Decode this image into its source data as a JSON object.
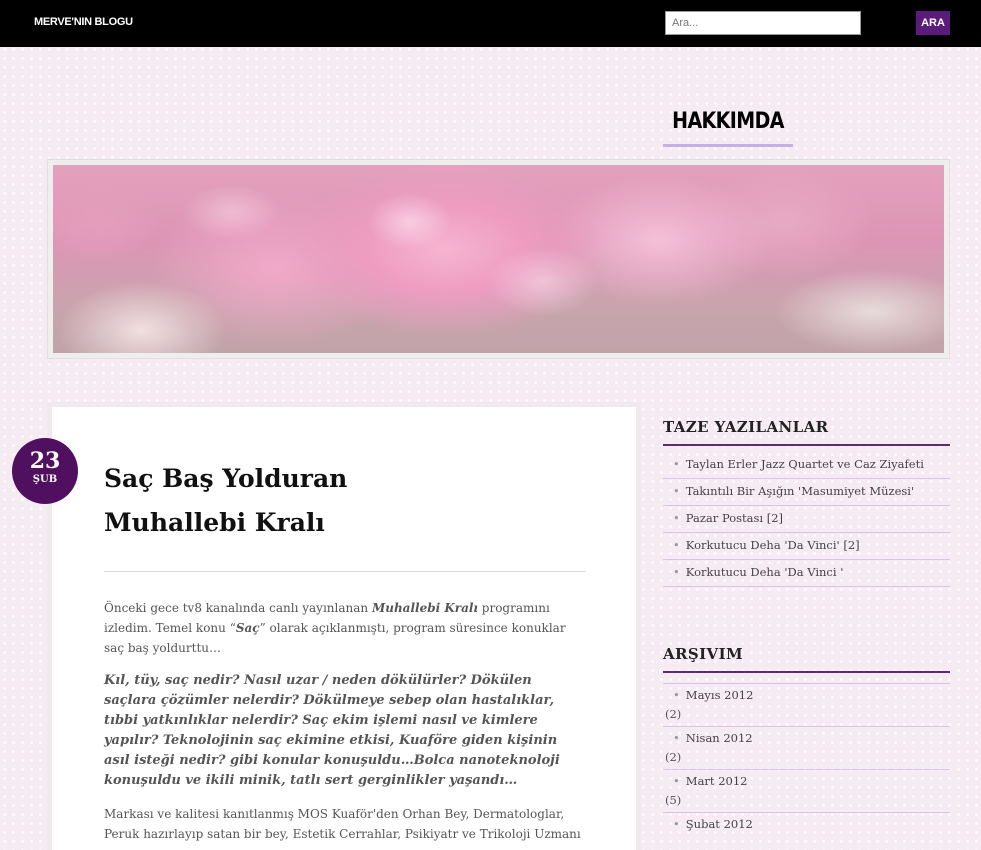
{
  "header": {
    "site_title": "MERVE'NIN BLOGU",
    "search_placeholder": "Ara...",
    "search_button": "ARA"
  },
  "nav": {
    "about_link": "HAKKIMDA"
  },
  "post": {
    "date_day": "23",
    "date_month": "ŞUB",
    "title_line1": "Saç Baş Yolduran",
    "title_line2": "Muhallebi Kralı",
    "p1_pre": "Önceki gece tv8 kanalında canlı yayınlanan ",
    "p1_program": "Muhallebi Kralı",
    "p1_mid": " programını izledim. Temel konu “",
    "p1_topic": "Saç",
    "p1_post": "” olarak açıklanmıştı, program süresince konuklar saç baş yoldurttu…",
    "p2": "Kıl, tüy, saç nedir? Nasıl uzar / neden dökülürler? Dökülen saçlara çözümler nelerdir? Dökülmeye sebep olan hastalıklar, tıbbi yatkınlıklar nelerdir? Saç ekim işlemi nasıl ve kimlere yapılır? Teknolojinin saç ekimine etkisi, Kuaföre giden kişinin asıl isteği nedir? gibi konular konuşuldu…Bolca nanoteknoloji konuşuldu ve ikili minik, tatlı sert gerginlikler yaşandı…",
    "p3": "Markası ve kalitesi kanıtlanmış MOS Kuaför'den Orhan Bey, Dermatologlar, Peruk hazırlayıp satan bir bey, Estetik Cerrahlar, Psikiyatr ve Trikoloji Uzmanı"
  },
  "sidebar": {
    "recent_title": "TAZE YAZILANLAR",
    "recent_posts": [
      "Taylan Erler Jazz Quartet ve Caz Ziyafeti",
      "Takıntılı Bir Aşığın 'Masumiyet Müzesi'",
      "Pazar Postası [2]",
      "Korkutucu Deha 'Da Vinci' [2]",
      "Korkutucu Deha 'Da Vinci '"
    ],
    "archive_title": "ARŞIVIM",
    "archive": [
      {
        "month": "Mayıs 2012",
        "count": "(2)"
      },
      {
        "month": "Nisan 2012",
        "count": "(2)"
      },
      {
        "month": "Mart 2012",
        "count": "(5)"
      },
      {
        "month": "Şubat 2012",
        "count": ""
      }
    ],
    "bullet": "•"
  }
}
